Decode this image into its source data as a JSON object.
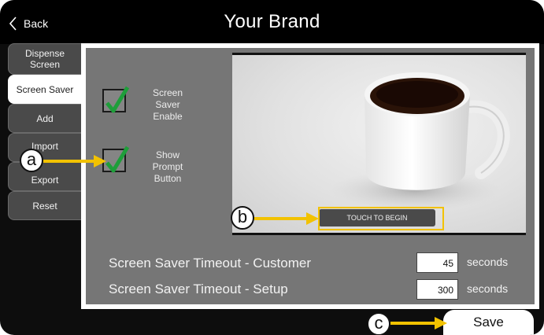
{
  "header": {
    "back_label": "Back",
    "title": "Your Brand"
  },
  "sidebar": {
    "tabs": [
      {
        "label": "Dispense Screen",
        "active": false
      },
      {
        "label": "Screen Saver",
        "active": true
      },
      {
        "label": "Add",
        "active": false
      },
      {
        "label": "Import",
        "active": false
      },
      {
        "label": "Export",
        "active": false
      },
      {
        "label": "Reset",
        "active": false
      }
    ]
  },
  "settings": {
    "screen_saver_enable": {
      "label": "Screen Saver Enable",
      "checked": true
    },
    "show_prompt_button": {
      "label": "Show Prompt Button",
      "checked": true
    }
  },
  "preview": {
    "touch_button_label": "TOUCH TO BEGIN"
  },
  "timeouts": {
    "customer": {
      "label": "Screen Saver Timeout - Customer",
      "value": "45",
      "unit": "seconds"
    },
    "setup": {
      "label": "Screen Saver Timeout - Setup",
      "value": "300",
      "unit": "seconds"
    }
  },
  "footer": {
    "save_label": "Save"
  },
  "callouts": {
    "a": "a",
    "b": "b",
    "c": "c"
  },
  "colors": {
    "accent_arrow": "#f2c200",
    "check_green": "#1e9e3a",
    "panel_gray": "#767676",
    "tab_gray": "#4a4a4a"
  },
  "icons": {
    "back": "chevron-left-icon",
    "check": "checkmark-icon"
  }
}
